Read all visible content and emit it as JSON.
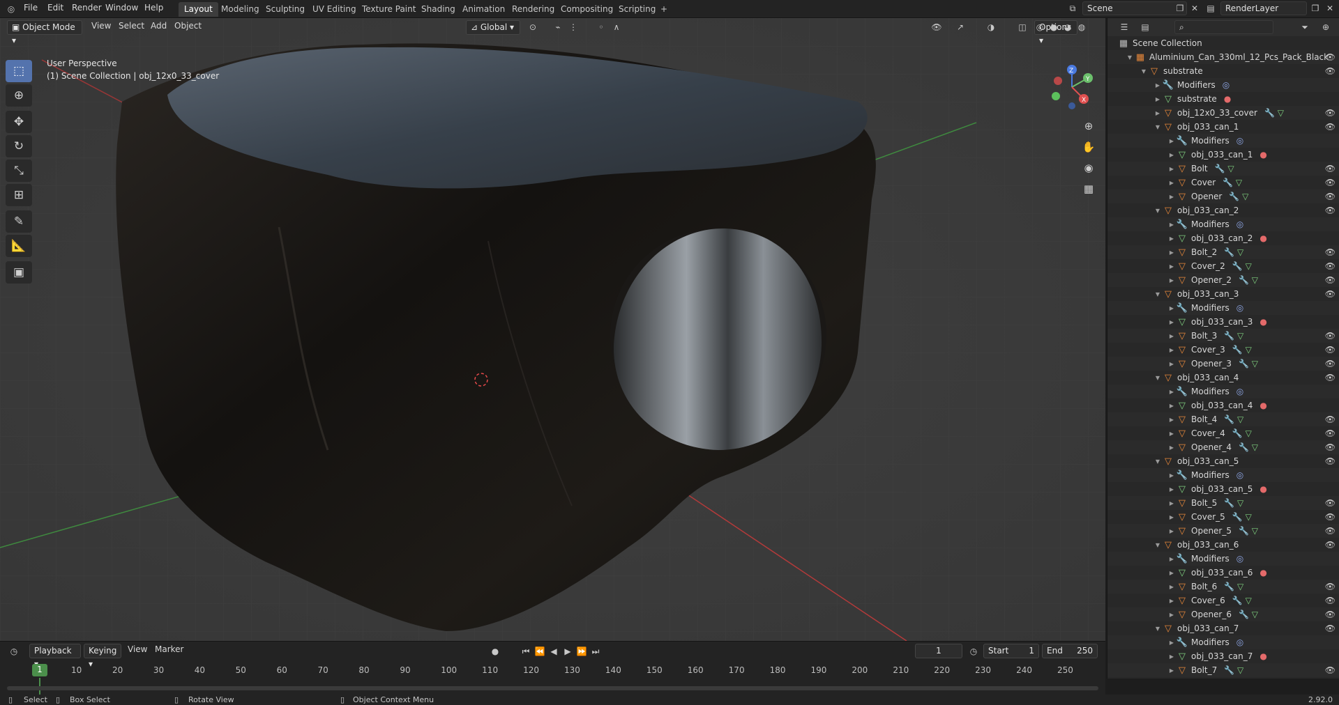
{
  "menus": [
    "File",
    "Edit",
    "Render",
    "Window",
    "Help"
  ],
  "workspaces": [
    {
      "label": "Layout",
      "active": true
    },
    {
      "label": "Modeling"
    },
    {
      "label": "Sculpting"
    },
    {
      "label": "UV Editing"
    },
    {
      "label": "Texture Paint"
    },
    {
      "label": "Shading"
    },
    {
      "label": "Animation"
    },
    {
      "label": "Rendering"
    },
    {
      "label": "Compositing"
    },
    {
      "label": "Scripting"
    }
  ],
  "scene_name": "Scene",
  "render_layer": "RenderLayer",
  "viewport": {
    "mode": "Object Mode",
    "menu": [
      "View",
      "Select",
      "Add",
      "Object"
    ],
    "orientation": "Global",
    "options_label": "Options",
    "perspective": "User Perspective",
    "collection_info": "(1) Scene Collection | obj_12x0_33_cover",
    "gizmo": {
      "x": "X",
      "y": "Y",
      "z": "Z"
    }
  },
  "outliner": {
    "root": "Scene Collection",
    "rows": [
      {
        "indent": 1,
        "icon": "collection",
        "label": "Aluminium_Can_330ml_12_Pcs_Pack_Black",
        "expanded": true,
        "eye": true
      },
      {
        "indent": 2,
        "icon": "object",
        "label": "substrate",
        "expanded": true,
        "eye": true
      },
      {
        "indent": 3,
        "icon": "wrench",
        "label": "Modifiers",
        "extra": "modifier",
        "eye": false
      },
      {
        "indent": 3,
        "icon": "mesh",
        "label": "substrate",
        "extra": "material",
        "eye": false
      },
      {
        "indent": 3,
        "icon": "object",
        "label": "obj_12x0_33_cover",
        "extra": "wrench-mesh",
        "eye": true
      },
      {
        "indent": 3,
        "icon": "object",
        "label": "obj_033_can_1",
        "expanded": true,
        "eye": true
      },
      {
        "indent": 4,
        "icon": "wrench",
        "label": "Modifiers",
        "extra": "modifier",
        "eye": false
      },
      {
        "indent": 4,
        "icon": "mesh",
        "label": "obj_033_can_1",
        "extra": "material",
        "eye": false
      },
      {
        "indent": 4,
        "icon": "object",
        "label": "Bolt",
        "extra": "wrench-mesh",
        "eye": true
      },
      {
        "indent": 4,
        "icon": "object",
        "label": "Cover",
        "extra": "wrench-mesh",
        "eye": true
      },
      {
        "indent": 4,
        "icon": "object",
        "label": "Opener",
        "extra": "wrench-mesh",
        "eye": true
      },
      {
        "indent": 3,
        "icon": "object",
        "label": "obj_033_can_2",
        "expanded": true,
        "eye": true
      },
      {
        "indent": 4,
        "icon": "wrench",
        "label": "Modifiers",
        "extra": "modifier",
        "eye": false
      },
      {
        "indent": 4,
        "icon": "mesh",
        "label": "obj_033_can_2",
        "extra": "material",
        "eye": false
      },
      {
        "indent": 4,
        "icon": "object",
        "label": "Bolt_2",
        "extra": "wrench-mesh",
        "eye": true
      },
      {
        "indent": 4,
        "icon": "object",
        "label": "Cover_2",
        "extra": "wrench-mesh",
        "eye": true
      },
      {
        "indent": 4,
        "icon": "object",
        "label": "Opener_2",
        "extra": "wrench-mesh",
        "eye": true
      },
      {
        "indent": 3,
        "icon": "object",
        "label": "obj_033_can_3",
        "expanded": true,
        "eye": true
      },
      {
        "indent": 4,
        "icon": "wrench",
        "label": "Modifiers",
        "extra": "modifier",
        "eye": false
      },
      {
        "indent": 4,
        "icon": "mesh",
        "label": "obj_033_can_3",
        "extra": "material",
        "eye": false
      },
      {
        "indent": 4,
        "icon": "object",
        "label": "Bolt_3",
        "extra": "wrench-mesh",
        "eye": true
      },
      {
        "indent": 4,
        "icon": "object",
        "label": "Cover_3",
        "extra": "wrench-mesh",
        "eye": true
      },
      {
        "indent": 4,
        "icon": "object",
        "label": "Opener_3",
        "extra": "wrench-mesh",
        "eye": true
      },
      {
        "indent": 3,
        "icon": "object",
        "label": "obj_033_can_4",
        "expanded": true,
        "eye": true
      },
      {
        "indent": 4,
        "icon": "wrench",
        "label": "Modifiers",
        "extra": "modifier",
        "eye": false
      },
      {
        "indent": 4,
        "icon": "mesh",
        "label": "obj_033_can_4",
        "extra": "material",
        "eye": false
      },
      {
        "indent": 4,
        "icon": "object",
        "label": "Bolt_4",
        "extra": "wrench-mesh",
        "eye": true
      },
      {
        "indent": 4,
        "icon": "object",
        "label": "Cover_4",
        "extra": "wrench-mesh",
        "eye": true
      },
      {
        "indent": 4,
        "icon": "object",
        "label": "Opener_4",
        "extra": "wrench-mesh",
        "eye": true
      },
      {
        "indent": 3,
        "icon": "object",
        "label": "obj_033_can_5",
        "expanded": true,
        "eye": true
      },
      {
        "indent": 4,
        "icon": "wrench",
        "label": "Modifiers",
        "extra": "modifier",
        "eye": false
      },
      {
        "indent": 4,
        "icon": "mesh",
        "label": "obj_033_can_5",
        "extra": "material",
        "eye": false
      },
      {
        "indent": 4,
        "icon": "object",
        "label": "Bolt_5",
        "extra": "wrench-mesh",
        "eye": true
      },
      {
        "indent": 4,
        "icon": "object",
        "label": "Cover_5",
        "extra": "wrench-mesh",
        "eye": true
      },
      {
        "indent": 4,
        "icon": "object",
        "label": "Opener_5",
        "extra": "wrench-mesh",
        "eye": true
      },
      {
        "indent": 3,
        "icon": "object",
        "label": "obj_033_can_6",
        "expanded": true,
        "eye": true
      },
      {
        "indent": 4,
        "icon": "wrench",
        "label": "Modifiers",
        "extra": "modifier",
        "eye": false
      },
      {
        "indent": 4,
        "icon": "mesh",
        "label": "obj_033_can_6",
        "extra": "material",
        "eye": false
      },
      {
        "indent": 4,
        "icon": "object",
        "label": "Bolt_6",
        "extra": "wrench-mesh",
        "eye": true
      },
      {
        "indent": 4,
        "icon": "object",
        "label": "Cover_6",
        "extra": "wrench-mesh",
        "eye": true
      },
      {
        "indent": 4,
        "icon": "object",
        "label": "Opener_6",
        "extra": "wrench-mesh",
        "eye": true
      },
      {
        "indent": 3,
        "icon": "object",
        "label": "obj_033_can_7",
        "expanded": true,
        "eye": true
      },
      {
        "indent": 4,
        "icon": "wrench",
        "label": "Modifiers",
        "extra": "modifier",
        "eye": false
      },
      {
        "indent": 4,
        "icon": "mesh",
        "label": "obj_033_can_7",
        "extra": "material",
        "eye": false
      },
      {
        "indent": 4,
        "icon": "object",
        "label": "Bolt_7",
        "extra": "wrench-mesh",
        "eye": true
      }
    ]
  },
  "timeline": {
    "menu": [
      "Playback",
      "Keying",
      "View",
      "Marker"
    ],
    "current_frame": "1",
    "start_label": "Start",
    "start": "1",
    "end_label": "End",
    "end": "250",
    "ticks": [
      "1",
      "10",
      "20",
      "30",
      "40",
      "50",
      "60",
      "70",
      "80",
      "90",
      "100",
      "110",
      "120",
      "130",
      "140",
      "150",
      "160",
      "170",
      "180",
      "190",
      "200",
      "210",
      "220",
      "230",
      "240",
      "250"
    ]
  },
  "statusbar": {
    "select": "Select",
    "box_select": "Box Select",
    "rotate_view": "Rotate View",
    "context_menu": "Object Context Menu",
    "version": "2.92.0"
  },
  "colors": {
    "accent": "#5473ad",
    "object_orange": "#e8883a",
    "mesh_green": "#7fd07f",
    "modifier_blue": "#8fa8e8",
    "material_red": "#e46a6a",
    "axis_red": "#c33b3b",
    "axis_green": "#3a9a3a"
  }
}
